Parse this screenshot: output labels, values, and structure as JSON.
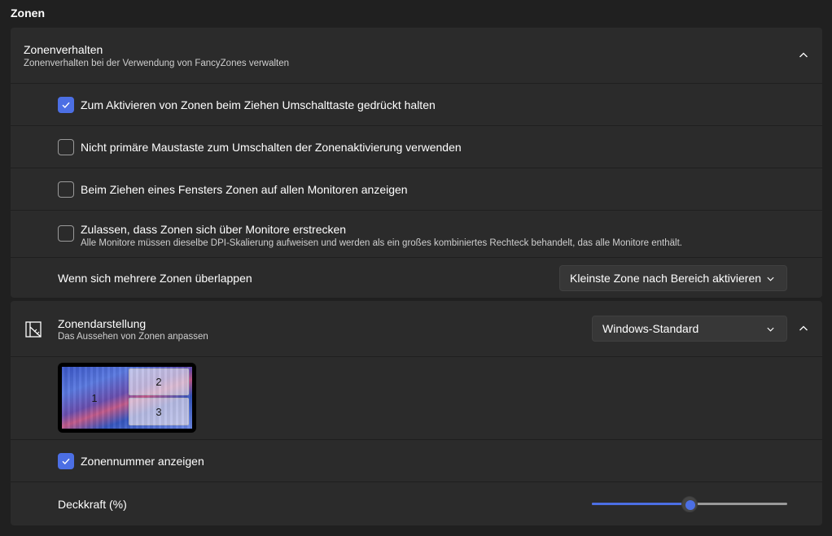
{
  "section": {
    "title": "Zonen"
  },
  "behavior": {
    "title": "Zonenverhalten",
    "subtitle": "Zonenverhalten bei der Verwendung von FancyZones verwalten",
    "options": [
      {
        "label": "Zum Aktivieren von Zonen beim Ziehen Umschalttaste gedrückt halten",
        "checked": true
      },
      {
        "label": "Nicht primäre Maustaste zum Umschalten der Zonenaktivierung verwenden",
        "checked": false
      },
      {
        "label": "Beim Ziehen eines Fensters Zonen auf allen Monitoren anzeigen",
        "checked": false
      },
      {
        "label": "Zulassen, dass Zonen sich über Monitore erstrecken",
        "checked": false,
        "description": "Alle Monitore müssen dieselbe DPI-Skalierung aufweisen und werden als ein großes kombiniertes Rechteck behandelt, das alle Monitore enthält."
      }
    ],
    "overlap": {
      "label": "Wenn sich mehrere Zonen überlappen",
      "selected": "Kleinste Zone nach Bereich aktivieren"
    }
  },
  "appearance": {
    "title": "Zonendarstellung",
    "subtitle": "Das Aussehen von Zonen anpassen",
    "icon": "zone-layout-icon",
    "theme_selected": "Windows-Standard",
    "preview": {
      "zones": [
        "1",
        "2",
        "3"
      ]
    },
    "show_numbers": {
      "label": "Zonennummer anzeigen",
      "checked": true
    },
    "opacity": {
      "label": "Deckkraft (%)",
      "value": 50,
      "min": 0,
      "max": 100
    }
  },
  "colors": {
    "accent": "#4c6fe4",
    "card": "#2b2b2b",
    "background": "#202020"
  }
}
